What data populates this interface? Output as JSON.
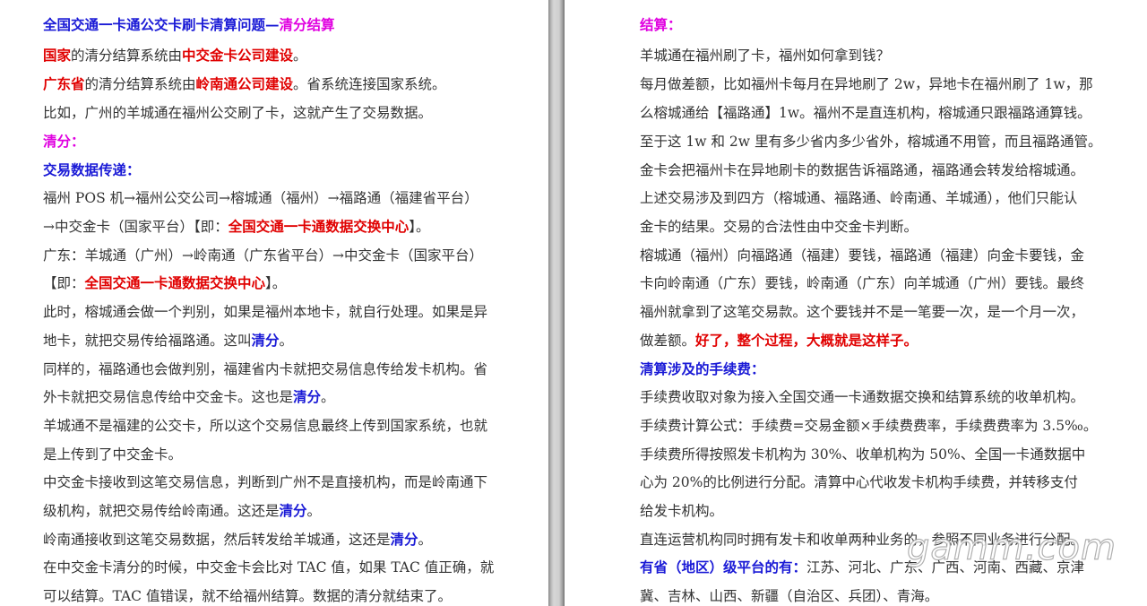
{
  "left_page": {
    "title": {
      "main": "全国交通一卡通公交卡刷卡清算问题—",
      "accent": "清分结算"
    },
    "l2": {
      "a": "国家",
      "b": "的清分结算系统由",
      "c": "中交金卡公司建设",
      "d": "。"
    },
    "l3": {
      "a": "广东省",
      "b": "的清分结算系统由",
      "c": "岭南通公司建设",
      "d": "。省系统连接国家系统。"
    },
    "l4": "比如，广州的羊城通在福州公交刷了卡，这就产生了交易数据。",
    "l5": "清分：",
    "l6": "交易数据传递：",
    "l7": "福州 POS 机→福州公交公司→榕城通（福州）→福路通（福建省平台）",
    "l8": {
      "a": "→中交金卡（国家平台）【即：",
      "b": "全国交通一卡通数据交换中心",
      "c": "】。"
    },
    "l9": "广东：羊城通（广州）→岭南通（广东省平台）→中交金卡（国家平台）",
    "l10": {
      "a": "【即：",
      "b": "全国交通一卡通数据交换中心",
      "c": "】。"
    },
    "l11": "此时，榕城通会做一个判别，如果是福州本地卡，就自行处理。如果是异",
    "l12": {
      "a": "地卡，就把交易传给福路通。这叫",
      "b": "清分",
      "c": "。"
    },
    "l13": "同样的，福路通也会做判别，福建省内卡就把交易信息传给发卡机构。省",
    "l14": {
      "a": "外卡就把交易信息传给中交金卡。这也是",
      "b": "清分",
      "c": "。"
    },
    "l15": "羊城通不是福建的公交卡，所以这个交易信息最终上传到国家系统，也就",
    "l16": "是上传到了中交金卡。",
    "l17": "中交金卡接收到这笔交易信息，判断到广州不是直接机构，而是岭南通下",
    "l18": {
      "a": "级机构，就把交易传给岭南通。这还是",
      "b": "清分",
      "c": "。"
    },
    "l19": {
      "a": "岭南通接收到这笔交易数据，然后转发给羊城通，这还是",
      "b": "清分",
      "c": "。"
    },
    "l20": "在中交金卡清分的时候，中交金卡会比对 TAC 值，如果 TAC 值正确，就",
    "l21": "可以结算。TAC 值错误，就不给福州结算。数据的清分就结束了。"
  },
  "right_page": {
    "r1": "结算：",
    "r2": "羊城通在福州刷了卡，福州如何拿到钱？",
    "r3": "每月做差额，比如福州卡每月在异地刷了 2w，异地卡在福州刷了 1w，那",
    "r4": "么榕城通给【福路通】1w。福州不是直连机构，榕城通只跟福路通算钱。",
    "r5": "至于这 1w 和 2w 里有多少省内多少省外，榕城通不用管，而且福路通管。",
    "r6": "金卡会把福州卡在异地刷卡的数据告诉福路通，福路通会转发给榕城通。",
    "r7": "上述交易涉及到四方（榕城通、福路通、岭南通、羊城通），他们只能认",
    "r8": "金卡的结果。交易的合法性由中交金卡判断。",
    "r9": "榕城通（福州）向福路通（福建）要钱，福路通（福建）向金卡要钱，金",
    "r10": "卡向岭南通（广东）要钱，岭南通（广东）向羊城通（广州）要钱。最终",
    "r11": "福州就拿到了这笔交易款。这个要钱并不是一笔要一次，是一个月一次，",
    "r12": {
      "a": "做差额。",
      "b": "好了，整个过程，大概就是这样子。"
    },
    "r13": "清算涉及的手续费：",
    "r14": "手续费收取对象为接入全国交通一卡通数据交换和结算系统的收单机构。",
    "r15": "手续费计算公式：手续费=交易金额×手续费费率，手续费费率为 3.5‰。",
    "r16": "手续费所得按照发卡机构为 30%、收单机构为 50%、全国一卡通数据中",
    "r17": "心为 20%的比例进行分配。清算中心代收发卡机构手续费，并转移支付",
    "r18": "给发卡机构。",
    "r19": "直连运营机构同时拥有发卡和收单两种业务的，参照不同业务进行分配。",
    "r20": {
      "a": "有省（地区）级平台的有：",
      "b": "江苏、河北、广东、广西、河南、西藏、京津"
    },
    "r21": "冀、吉林、山西、新疆（自治区、兵团）、青海。"
  },
  "watermark": "gamm.com"
}
